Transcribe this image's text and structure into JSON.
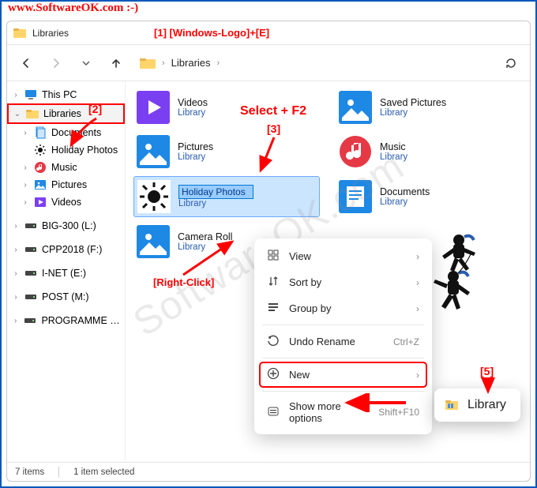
{
  "url_text": "www.SoftwareOK.com :-)",
  "titlebar": {
    "title": "Libraries"
  },
  "annotations": {
    "a1": "[1]   [Windows-Logo]+[E]",
    "a2": "[2]",
    "a3_hint": "Select + F2",
    "a3": "[3]",
    "rightclick": "[Right-Click]",
    "a5": "[5]"
  },
  "toolbar": {
    "back": "←",
    "forward": "→",
    "up": "↑",
    "refresh": "⟳"
  },
  "breadcrumb": {
    "crumb1": "Libraries",
    "sep": "›"
  },
  "sidebar": {
    "items": [
      {
        "label": "This PC",
        "icon": "monitor",
        "chev": "›"
      },
      {
        "label": "Libraries",
        "icon": "folder",
        "chev": "⌄",
        "selected": true
      },
      {
        "label": "Documents",
        "icon": "documents",
        "chev": "›",
        "indent": true
      },
      {
        "label": "Holiday Photos",
        "icon": "sun",
        "chev": "",
        "indent": true
      },
      {
        "label": "Music",
        "icon": "music",
        "chev": "›",
        "indent": true
      },
      {
        "label": "Pictures",
        "icon": "pictures",
        "chev": "›",
        "indent": true
      },
      {
        "label": "Videos",
        "icon": "videos",
        "chev": "›",
        "indent": true
      },
      {
        "label": "BIG-300 (L:)",
        "icon": "drive",
        "chev": "›"
      },
      {
        "label": "CPP2018 (F:)",
        "icon": "drive",
        "chev": "›"
      },
      {
        "label": "I-NET (E:)",
        "icon": "drive",
        "chev": "›"
      },
      {
        "label": "POST (M:)",
        "icon": "drive",
        "chev": "›"
      },
      {
        "label": "PROGRAMME (D:)",
        "icon": "drive",
        "chev": "›"
      }
    ]
  },
  "libraries": [
    {
      "name": "Videos",
      "sub": "Library",
      "icon": "videos-big"
    },
    {
      "name": "Saved Pictures",
      "sub": "Library",
      "icon": "pictures-big"
    },
    {
      "name": "Pictures",
      "sub": "Library",
      "icon": "pictures-big"
    },
    {
      "name": "Music",
      "sub": "Library",
      "icon": "music-big"
    },
    {
      "name": "Holiday Photos",
      "sub": "Library",
      "icon": "sun-big",
      "renaming": true
    },
    {
      "name": "Documents",
      "sub": "Library",
      "icon": "documents-big"
    },
    {
      "name": "Camera Roll",
      "sub": "Library",
      "icon": "pictures-big"
    }
  ],
  "context_menu": {
    "items": [
      {
        "label": "View",
        "icon": "view",
        "sub": true
      },
      {
        "label": "Sort by",
        "icon": "sort",
        "sub": true
      },
      {
        "label": "Group by",
        "icon": "group",
        "sub": true
      },
      {
        "sep": true
      },
      {
        "label": "Undo Rename",
        "icon": "undo",
        "shortcut": "Ctrl+Z"
      },
      {
        "sep": true
      },
      {
        "label": "New",
        "icon": "plus",
        "sub": true,
        "highlighted": true
      },
      {
        "sep": true
      },
      {
        "label": "Show more options",
        "icon": "more",
        "shortcut": "Shift+F10"
      }
    ]
  },
  "submenu": {
    "label": "Library",
    "icon": "library"
  },
  "statusbar": {
    "items": "7 items",
    "selected": "1 item selected"
  }
}
